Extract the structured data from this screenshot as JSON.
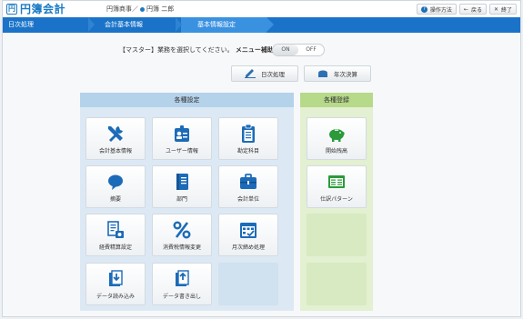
{
  "app": {
    "logo_mark": "円",
    "logo_text": "円簿会計",
    "company": "円簿商事／",
    "user": "円簿 二郎"
  },
  "header_buttons": {
    "help": "操作方法",
    "back": "戻る",
    "close": "終了"
  },
  "breadcrumb": [
    "日次処理",
    "会計基本情報",
    "基本情報設定"
  ],
  "master": {
    "prompt": "【マスター】業務を選択してください。",
    "menu_assist": "メニュー補助",
    "on": "ON",
    "off": "OFF"
  },
  "top_buttons": {
    "daily": "日次処理",
    "yearly": "年次決算"
  },
  "panels": {
    "settings_title": "各種設定",
    "registration_title": "各種登録"
  },
  "settings_tiles": [
    {
      "label": "会計基本情報",
      "icon": "tools-icon"
    },
    {
      "label": "ユーザー情報",
      "icon": "user-card-icon"
    },
    {
      "label": "勘定科目",
      "icon": "clipboard-icon"
    },
    {
      "label": "摘要",
      "icon": "speech-bubble-icon"
    },
    {
      "label": "部門",
      "icon": "book-icon"
    },
    {
      "label": "会計単位",
      "icon": "briefcase-icon"
    },
    {
      "label": "経費精算設定",
      "icon": "expense-document-icon"
    },
    {
      "label": "消費税情報変更",
      "icon": "percent-icon"
    },
    {
      "label": "月次締め処理",
      "icon": "calendar-icon"
    },
    {
      "label": "データ読み込み",
      "icon": "data-import-icon"
    },
    {
      "label": "データ書き出し",
      "icon": "data-export-icon"
    }
  ],
  "registration_tiles": [
    {
      "label": "開始残高",
      "icon": "piggy-bank-icon"
    },
    {
      "label": "仕訳パターン",
      "icon": "ledger-pattern-icon"
    }
  ]
}
